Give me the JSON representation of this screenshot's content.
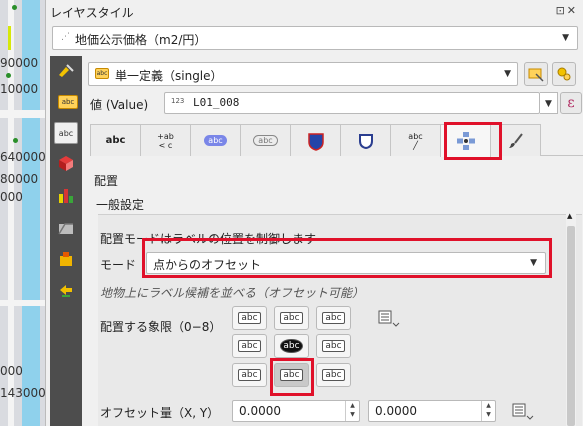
{
  "map": {
    "numbers": [
      "90000",
      "10000",
      "640000",
      "80000",
      "000",
      "000",
      "143000"
    ]
  },
  "panel": {
    "title": "レイヤスタイル",
    "title_buttons": "⊡✕",
    "layer_name": "地価公示価格（m2/円）",
    "renderer": "単一定義（single）",
    "value_label": "値 (Value)",
    "value_type_icon": "123",
    "value_field": "L01_008",
    "epsilon_glyph": "ε"
  },
  "tabs": [
    {
      "name": "tab-text",
      "glyph": "abc"
    },
    {
      "name": "tab-formatting",
      "glyph": "+ab\n< c"
    },
    {
      "name": "tab-buffer",
      "glyph": "abc"
    },
    {
      "name": "tab-mask",
      "glyph": "abc"
    },
    {
      "name": "tab-background",
      "glyph": "shield"
    },
    {
      "name": "tab-shadow",
      "glyph": "shadow"
    },
    {
      "name": "tab-callouts",
      "glyph": "abc"
    },
    {
      "name": "tab-placement",
      "glyph": "placement"
    },
    {
      "name": "tab-rendering",
      "glyph": "brush"
    }
  ],
  "placement": {
    "section_title": "配置",
    "group_title": "一般設定",
    "info": "配置モードはラベルの位置を制御します",
    "mode_label": "モード",
    "mode_value": "点からのオフセット",
    "hint": "地物上にラベル候補を並べる（オフセット可能）",
    "quadrant_label": "配置する象限（0−8）",
    "quadrant_glyph": "abc",
    "selected_quadrant": 7,
    "offset_label": "オフセット量（X, Y）",
    "offset_x": "0.0000",
    "offset_y": "0.0000"
  },
  "colors": {
    "highlight": "#e0112a",
    "sidebar": "#4d4d4d"
  }
}
